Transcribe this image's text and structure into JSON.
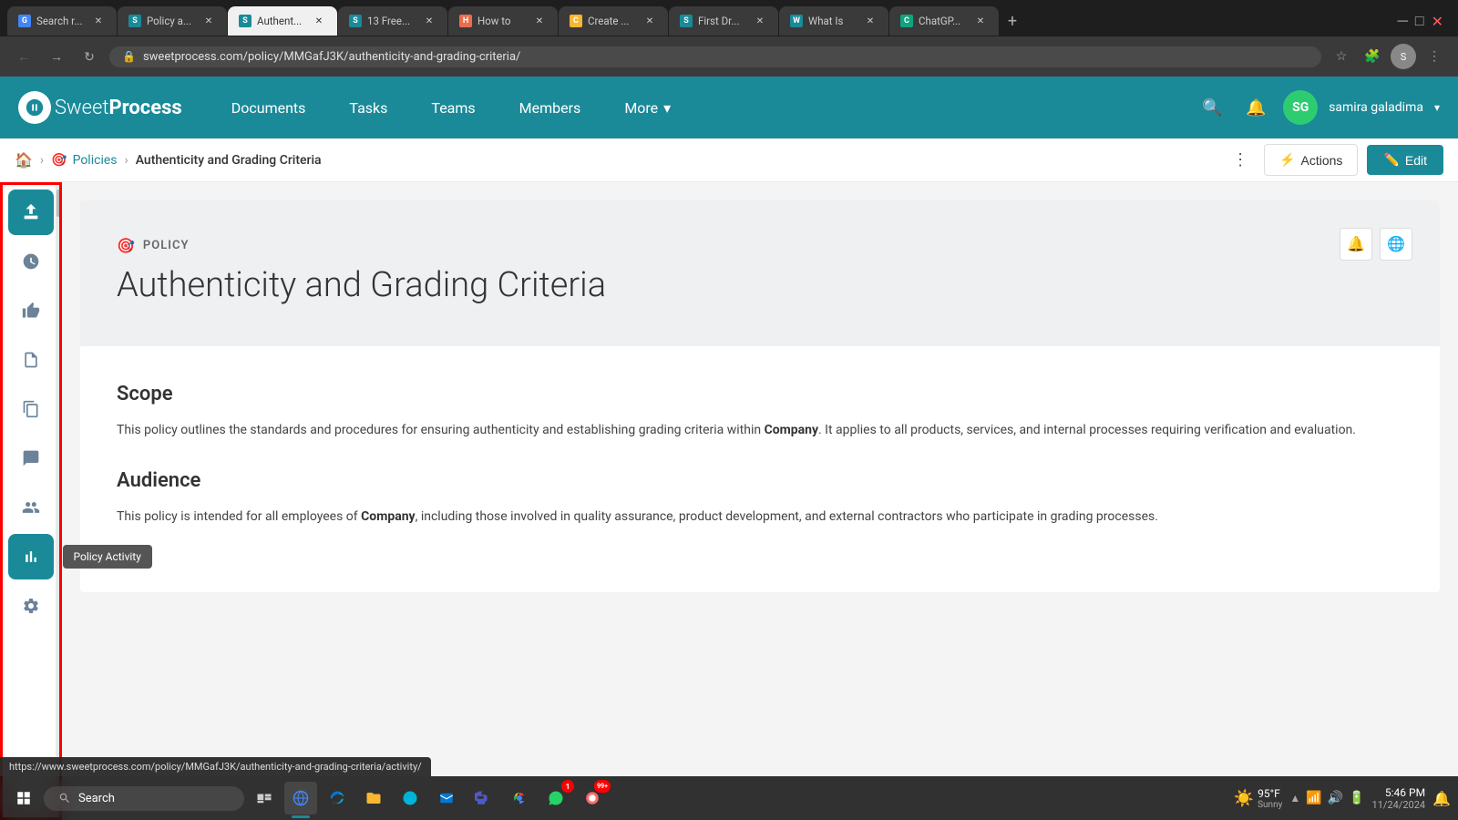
{
  "browser": {
    "tabs": [
      {
        "id": "search",
        "label": "Search r...",
        "favicon_color": "#4285F4",
        "favicon_letter": "G",
        "active": false
      },
      {
        "id": "policy",
        "label": "Policy a...",
        "favicon_color": "#1a8a99",
        "favicon_letter": "S",
        "active": false
      },
      {
        "id": "authen",
        "label": "Authent...",
        "favicon_color": "#1a8a99",
        "favicon_letter": "S",
        "active": true
      },
      {
        "id": "13free",
        "label": "13 Free...",
        "favicon_color": "#1a8a99",
        "favicon_letter": "S",
        "active": false
      },
      {
        "id": "howto",
        "label": "How to",
        "favicon_color": "#ee6c4d",
        "favicon_letter": "H",
        "active": false
      },
      {
        "id": "create",
        "label": "Create ...",
        "favicon_color": "#f7b731",
        "favicon_letter": "C",
        "active": false
      },
      {
        "id": "firstdr",
        "label": "First Dr...",
        "favicon_color": "#1a8a99",
        "favicon_letter": "S",
        "active": false
      },
      {
        "id": "whatis",
        "label": "What Is",
        "favicon_color": "#1a8a99",
        "favicon_letter": "W",
        "active": false
      },
      {
        "id": "chatgp",
        "label": "ChatGP...",
        "favicon_color": "#10a37f",
        "favicon_letter": "C",
        "active": false
      }
    ],
    "address": "sweetprocess.com/policy/MMGafJ3K/authenticity-and-grading-criteria/"
  },
  "nav": {
    "logo_sweet": "Sweet",
    "logo_process": "Process",
    "items": [
      {
        "label": "Documents",
        "id": "documents"
      },
      {
        "label": "Tasks",
        "id": "tasks"
      },
      {
        "label": "Teams",
        "id": "teams"
      },
      {
        "label": "Members",
        "id": "members"
      },
      {
        "label": "More",
        "id": "more",
        "has_arrow": true
      }
    ],
    "user_initials": "SG",
    "user_name": "samira galadima"
  },
  "breadcrumb": {
    "policies_label": "Policies",
    "current": "Authenticity and Grading Criteria",
    "actions_label": "Actions",
    "edit_label": "Edit"
  },
  "sidebar": {
    "items": [
      {
        "id": "upload",
        "icon": "↑",
        "tooltip": "",
        "active": true
      },
      {
        "id": "clock",
        "icon": "🕐",
        "tooltip": ""
      },
      {
        "id": "like",
        "icon": "👍",
        "tooltip": ""
      },
      {
        "id": "doc",
        "icon": "📄",
        "tooltip": ""
      },
      {
        "id": "docs",
        "icon": "📋",
        "tooltip": ""
      },
      {
        "id": "chat",
        "icon": "💬",
        "tooltip": ""
      },
      {
        "id": "people",
        "icon": "👥",
        "tooltip": ""
      },
      {
        "id": "chart",
        "icon": "📊",
        "tooltip": "Policy Activity",
        "highlighted": true
      }
    ]
  },
  "policy": {
    "type_label": "POLICY",
    "title": "Authenticity and Grading Criteria",
    "scope_heading": "Scope",
    "scope_text_1": "This policy outlines the standards and procedures for ensuring authenticity and establishing grading criteria within ",
    "scope_company": "Company",
    "scope_text_2": ". It applies to all products, services, and internal processes requiring verification and evaluation.",
    "audience_heading": "Audience",
    "audience_text_1": "This policy is intended for all employees of ",
    "audience_company": "Company",
    "audience_text_2": ", including those involved in quality assurance, product development, and external contractors who participate in grading processes."
  },
  "tooltip": {
    "policy_activity": "Policy Activity"
  },
  "status_bar": {
    "url": "https://www.sweetprocess.com/policy/MMGafJ3K/authenticity-and-grading-criteria/activity/"
  },
  "taskbar": {
    "search_placeholder": "Search",
    "weather_temp": "95°F",
    "weather_desc": "Sunny",
    "time": "5:46 PM",
    "date": "11/24/2024"
  }
}
